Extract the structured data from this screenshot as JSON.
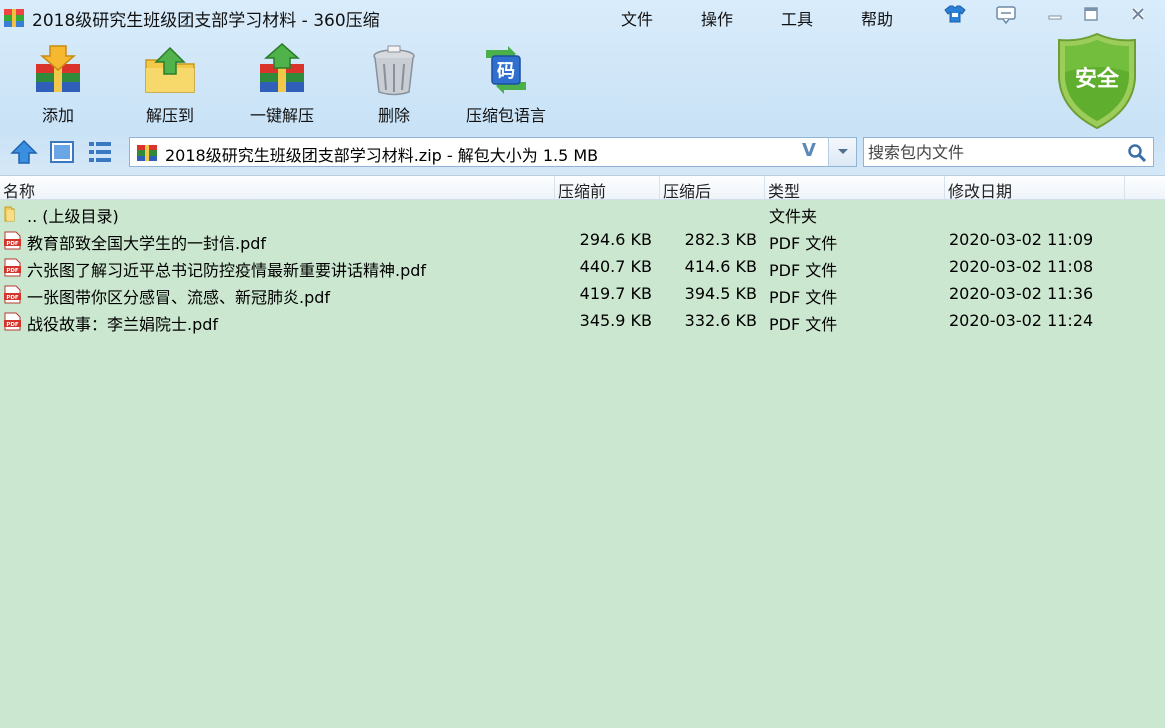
{
  "window": {
    "title": "2018级研究生班级团支部学习材料 - 360压缩",
    "menus": [
      "文件",
      "操作",
      "工具",
      "帮助"
    ]
  },
  "toolbar": {
    "add_label": "添加",
    "extract_to_label": "解压到",
    "one_click_extract_label": "一键解压",
    "delete_label": "删除",
    "language_label": "压缩包语言",
    "security_badge": "安全",
    "language_icon_char": "码"
  },
  "nav": {
    "path_text": "2018级研究生班级团支部学习材料.zip - 解包大小为 1.5 MB",
    "path_v": "V",
    "search_placeholder": "搜索包内文件"
  },
  "columns": {
    "name": "名称",
    "packed": "压缩前",
    "compressed": "压缩后",
    "type": "类型",
    "modified": "修改日期"
  },
  "rows": [
    {
      "name": ".. (上级目录)",
      "packed": "",
      "compressed": "",
      "type": "文件夹",
      "modified": "",
      "icon": "folder-icon"
    },
    {
      "name": "教育部致全国大学生的一封信.pdf",
      "packed": "294.6 KB",
      "compressed": "282.3 KB",
      "type": "PDF 文件",
      "modified": "2020-03-02 11:09",
      "icon": "pdf-icon"
    },
    {
      "name": "六张图了解习近平总书记防控疫情最新重要讲话精神.pdf",
      "packed": "440.7 KB",
      "compressed": "414.6 KB",
      "type": "PDF 文件",
      "modified": "2020-03-02 11:08",
      "icon": "pdf-icon"
    },
    {
      "name": "一张图带你区分感冒、流感、新冠肺炎.pdf",
      "packed": "419.7 KB",
      "compressed": "394.5 KB",
      "type": "PDF 文件",
      "modified": "2020-03-02 11:36",
      "icon": "pdf-icon"
    },
    {
      "name": "战役故事：李兰娟院士.pdf",
      "packed": "345.9 KB",
      "compressed": "332.6 KB",
      "type": "PDF 文件",
      "modified": "2020-03-02 11:24",
      "icon": "pdf-icon"
    }
  ],
  "pdf_badge": "PDF",
  "colors": {
    "list_background": "#cbe7cf",
    "window_background": "#cfe6f8",
    "shield_green": "#5fae2e"
  }
}
